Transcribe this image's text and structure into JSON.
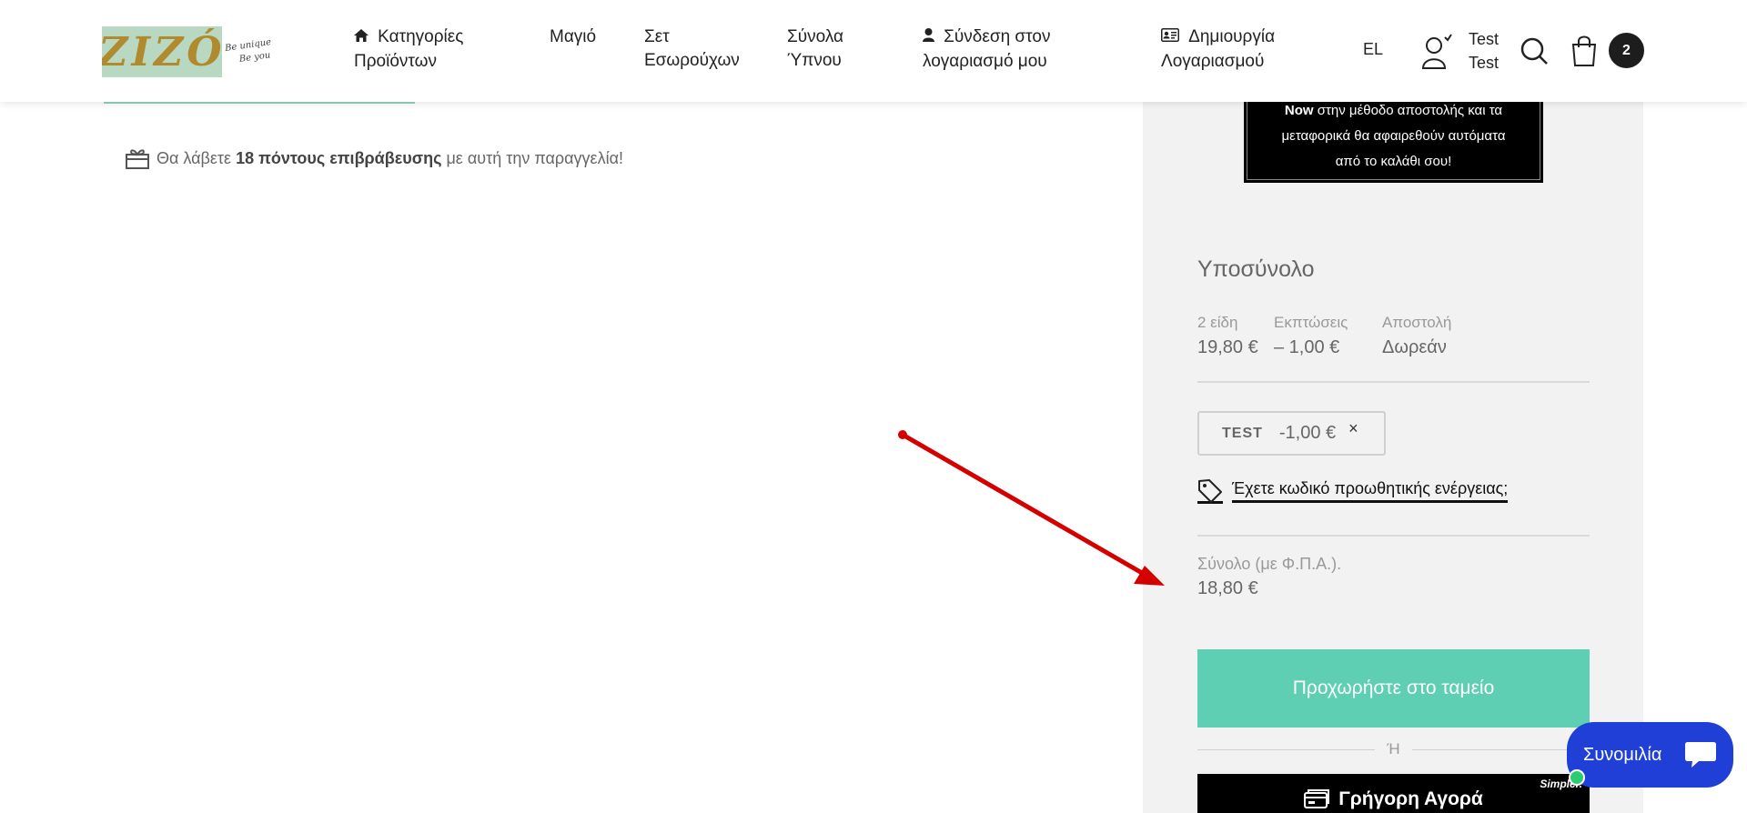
{
  "header": {
    "logo_text": "ZIZÓ",
    "logo_script": [
      "Be unique",
      "Be you"
    ],
    "nav": [
      {
        "icon": "home-icon",
        "lines": [
          "Κατηγορίες",
          "Προϊόντων"
        ]
      },
      {
        "icon": "",
        "lines": [
          "Μαγιό",
          ""
        ]
      },
      {
        "icon": "",
        "lines": [
          "Σετ",
          "Εσωρούχων"
        ]
      },
      {
        "icon": "",
        "lines": [
          "Σύνολα",
          "Ύπνου"
        ]
      },
      {
        "icon": "user-icon",
        "lines": [
          "Σύνδεση στον",
          "λογαριασμό μου"
        ]
      },
      {
        "icon": "id-card-icon",
        "lines": [
          "Δημιουργία",
          "Λογαριασμού"
        ]
      }
    ],
    "language": "EL",
    "user_name": [
      "Test",
      "Test"
    ],
    "cart_count": "2"
  },
  "rewards": {
    "prefix": "Θα λάβετε ",
    "points": "18 πόντους επιβράβευσης",
    "suffix": " με αυτή την παραγγελία!"
  },
  "promo_banner": {
    "lines_html_parts": [
      {
        "bold": "Now",
        "rest": " στην μέθοδο αποστολής και τα"
      },
      {
        "bold": "",
        "rest": "μεταφορικά θα αφαιρεθούν αυτόματα"
      },
      {
        "bold": "",
        "rest": "από το καλάθι σου!"
      }
    ]
  },
  "summary": {
    "title": "Υποσύνολο",
    "items_label": "2 είδη",
    "items_value": "19,80 €",
    "discount_label": "Εκπτώσεις",
    "discount_value": "– 1,00 €",
    "shipping_label": "Αποστολή",
    "shipping_value": "Δωρεάν",
    "coupon_code": "TEST",
    "coupon_amount": "-1,00 €",
    "coupon_remove": "×",
    "promo_link": "Έχετε κωδικό προωθητικής ενέργειας;",
    "total_label": "Σύνολο (με Φ.Π.Α.).",
    "total_value": "18,80 €",
    "checkout_label": "Προχωρήστε στο ταμείο",
    "or_label": "Ή",
    "fast_buy_label": "Γρήγορη Αγορά",
    "fast_buy_brand": "Simpler."
  },
  "chat": {
    "label": "Συνομιλία"
  },
  "colors": {
    "accent_green": "#5ecfb2",
    "chat_blue": "#1f3fd6",
    "arrow_red": "#d40000"
  }
}
